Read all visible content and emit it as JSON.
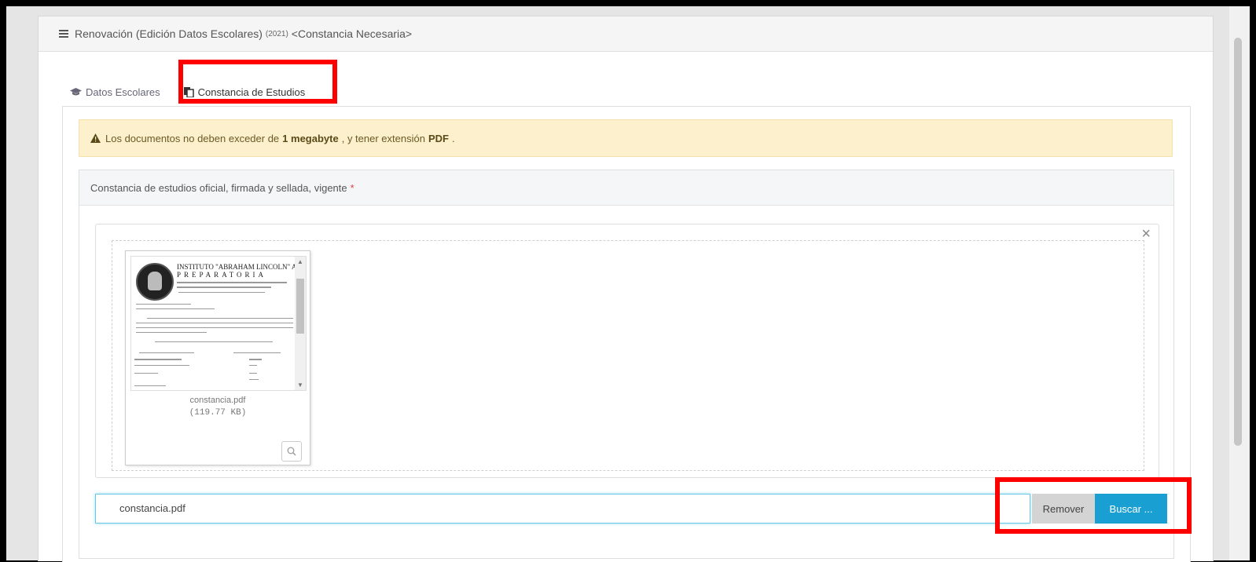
{
  "header": {
    "title": "Renovación (Edición Datos Escolares)",
    "year": "(2021)",
    "note": "<Constancia Necesaria>"
  },
  "tabs": [
    {
      "label": "Datos Escolares",
      "icon": "graduation-cap-icon"
    },
    {
      "label": "Constancia de Estudios",
      "icon": "copy-document-icon"
    }
  ],
  "alert": {
    "prefix": "Los documentos no deben exceder de",
    "size": "1 megabyte",
    "middle": ", y tener extensión",
    "ext": "PDF",
    "suffix": "."
  },
  "panel": {
    "heading": "Constancia de estudios oficial, firmada y sellada, vigente",
    "required_mark": "*"
  },
  "preview": {
    "close": "×",
    "file_name": "constancia.pdf",
    "file_size": "(119.77 KB)",
    "doc_title": "INSTITUTO \"ABRAHAM LINCOLN\" A.C.",
    "doc_subtitle": "PREPARATORIA"
  },
  "file_input": {
    "value": "constancia.pdf"
  },
  "buttons": {
    "remove": "Remover",
    "search": "Buscar ..."
  },
  "colors": {
    "highlight": "#ff0000",
    "primary": "#1a9fd2",
    "alert_bg": "#fcf0cd"
  }
}
